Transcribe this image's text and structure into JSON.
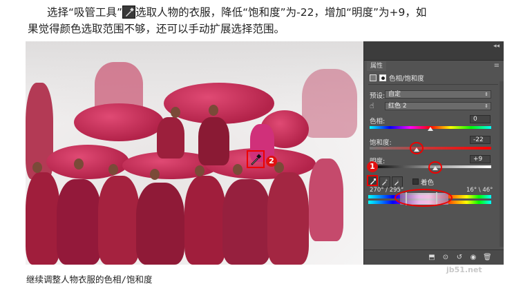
{
  "paragraph": {
    "line1_before_tool": "选择“吸管工具”",
    "line1_after_tool": "选取人物的衣服，降低“饱和度”为-22，增加“明度”为+9，如",
    "line2": "果觉得颜色选取范围不够，还可以手动扩展选择范围。"
  },
  "photo": {
    "marker2": "2"
  },
  "panel": {
    "tab_label": "属性",
    "collapse_glyph": "◂◂",
    "menu_glyph": "≡",
    "title": "色相/饱和度",
    "preset_label": "预设:",
    "preset_value": "自定",
    "channel_value": "红色 2",
    "hue_label": "色相:",
    "hue_value": "0",
    "saturation_label": "饱和度:",
    "saturation_value": "-22",
    "lightness_label": "明度:",
    "lightness_value": "+9",
    "colorize_label": "着色",
    "marker1": "1",
    "range_left": "270° / 295°",
    "range_right": "16° \\ 46°",
    "levels": {
      "hue": 0.5,
      "saturation": 0.39,
      "lightness": 0.55
    }
  },
  "caption": "继续调整人物衣服的色相/饱和度",
  "watermark": "jb51.net",
  "colors": {
    "panel_bg": "#535353",
    "highlight": "#ee0000",
    "robe": "#a01e3c"
  }
}
